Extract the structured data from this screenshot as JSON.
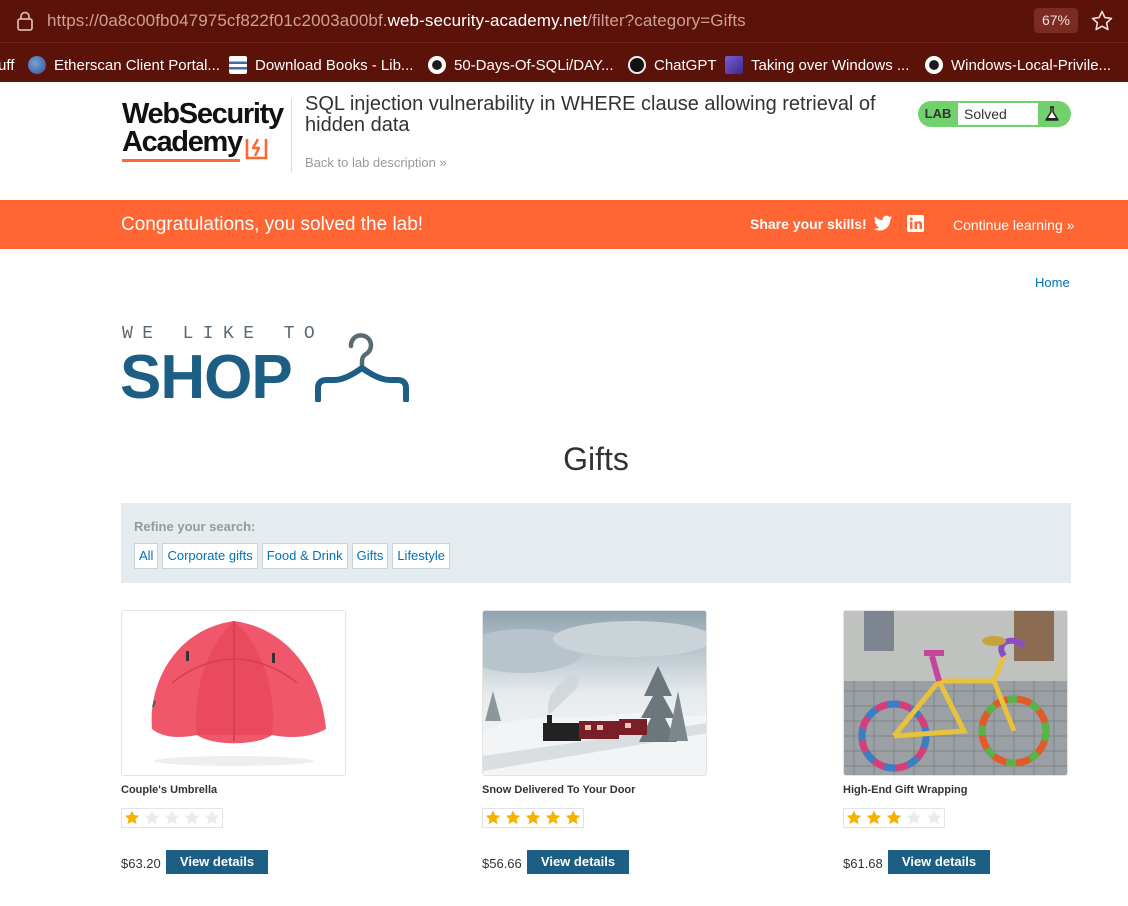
{
  "browser": {
    "url_prefix": "https://0a8c00fb047975cf822f01c2003a00bf.",
    "url_host": "web-security-academy.net",
    "url_suffix": "/filter?category=Gifts",
    "zoom": "67%",
    "bookmarks": [
      {
        "label": "uff",
        "icon": "none"
      },
      {
        "label": "Etherscan Client Portal...",
        "icon": "etherscan-icon"
      },
      {
        "label": "Download Books - Lib...",
        "icon": "library-icon"
      },
      {
        "label": "50-Days-Of-SQLi/DAY...",
        "icon": "github-icon"
      },
      {
        "label": "ChatGPT",
        "icon": "chatgpt-icon"
      },
      {
        "label": "Taking over Windows ...",
        "icon": "ri-icon"
      },
      {
        "label": "Windows-Local-Privile...",
        "icon": "github-icon"
      }
    ]
  },
  "lab": {
    "logo_line1": "WebSecurity",
    "logo_line2": "Academy",
    "title": "SQL injection vulnerability in WHERE clause allowing retrieval of hidden data",
    "back_link": "Back to lab description",
    "status_label": "LAB",
    "status_value": "Solved"
  },
  "banner": {
    "message": "Congratulations, you solved the lab!",
    "share": "Share your skills!",
    "continue": "Continue learning"
  },
  "page": {
    "home_link": "Home",
    "shop_tagline": "WE LIKE TO",
    "shop_word": "SHOP",
    "heading": "Gifts",
    "refine_label": "Refine your search:",
    "categories": [
      "All",
      "Corporate gifts",
      "Food & Drink",
      "Gifts",
      "Lifestyle"
    ]
  },
  "products": [
    {
      "name": "Couple's Umbrella",
      "rating": 1,
      "price": "$63.20",
      "button": "View details"
    },
    {
      "name": "Snow Delivered To Your Door",
      "rating": 5,
      "price": "$56.66",
      "button": "View details"
    },
    {
      "name": "High-End Gift Wrapping",
      "rating": 3,
      "price": "$61.68",
      "button": "View details"
    }
  ],
  "colors": {
    "browser_chrome": "#5b1208",
    "brand_orange": "#ff6633",
    "brand_blue": "#1d5f84",
    "link_blue": "#0071bc",
    "solved_green": "#70d16d",
    "star_gold": "#f5b301"
  }
}
